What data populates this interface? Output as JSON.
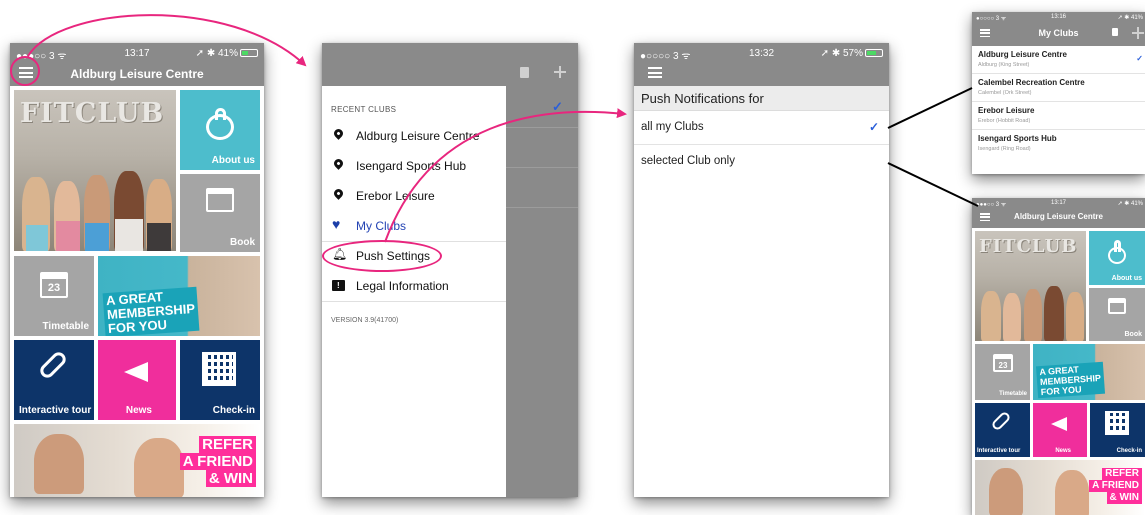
{
  "colors": {
    "topbar_gray": "#8a8a8a",
    "teal": "#4dbdcc",
    "tile_gray": "#a5a5a5",
    "navy": "#0d3469",
    "pink": "#f02e9c",
    "annotation_pink": "#e8267e",
    "check_blue": "#2b5fd9"
  },
  "phone_home": {
    "status": {
      "carrier": "●●●○○ 3 ᯤ",
      "time": "13:17",
      "right": "➚ ✱ 41%"
    },
    "title": "Aldburg Leisure Centre",
    "brand": "FITCLUB",
    "tiles": {
      "about": "About us",
      "book": "Book",
      "timetable": "Timetable",
      "calendar_day": "23",
      "membership": [
        "A GREAT",
        "MEMBERSHIP",
        "FOR YOU"
      ],
      "tour": "Interactive tour",
      "news": "News",
      "checkin": "Check-in",
      "refer": [
        "REFER",
        "A FRIEND",
        "& WIN"
      ]
    }
  },
  "phone_drawer": {
    "section_title": "RECENT CLUBS",
    "recent_clubs": [
      "Aldburg Leisure Centre",
      "Isengard Sports Hub",
      "Erebor Leisure"
    ],
    "my_clubs": "My Clubs",
    "push_settings": "Push Settings",
    "legal": "Legal Information",
    "version": "VERSION  3.9(41700)",
    "check": "✓"
  },
  "phone_push": {
    "status": {
      "carrier": "●○○○○ 3 ᯤ",
      "time": "13:32",
      "right": "➚ ✱ 57%"
    },
    "header": "Push Notifications for",
    "options": [
      {
        "label": "all my Clubs",
        "selected": "✓"
      },
      {
        "label": "selected Club only",
        "selected": ""
      }
    ]
  },
  "phone_myclubs": {
    "status": {
      "carrier": "●○○○○ 3 ᯤ",
      "time": "13:16",
      "right": "➚ ✱ 41%"
    },
    "title": "My Clubs",
    "check": "✓",
    "clubs": [
      {
        "name": "Aldburg Leisure Centre",
        "sub": "Aldburg (King Street)"
      },
      {
        "name": "Calembel Recreation Centre",
        "sub": "Calembel (Ork Street)"
      },
      {
        "name": "Erebor Leisure",
        "sub": "Erebor (Hobbit Road)"
      },
      {
        "name": "Isengard Sports Hub",
        "sub": "Isengard (Ring Road)"
      }
    ]
  },
  "phone_home_small": {
    "status": {
      "carrier": "●●●○○ 3 ᯤ",
      "time": "13:17",
      "right": "➚ ✱ 41%"
    },
    "title": "Aldburg Leisure Centre"
  }
}
